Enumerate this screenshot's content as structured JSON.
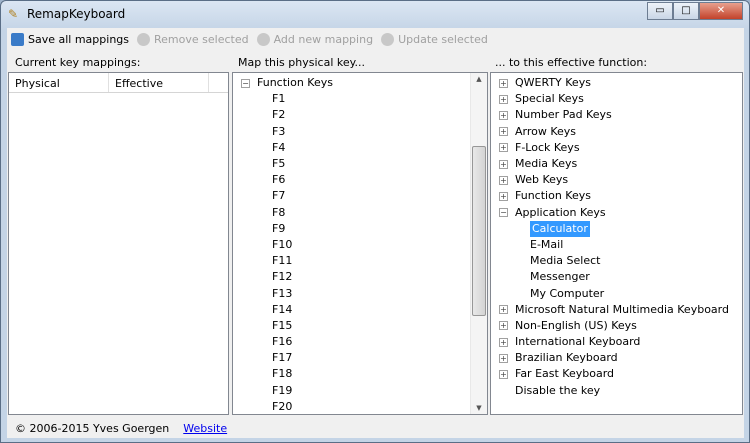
{
  "window": {
    "title": "RemapKeyboard",
    "min": "▭",
    "max": "□",
    "close": "✕"
  },
  "toolbar": {
    "save": "Save all mappings",
    "remove": "Remove selected",
    "add": "Add new mapping",
    "update": "Update selected"
  },
  "left": {
    "label": "Current key mappings:",
    "columns": [
      "Physical",
      "Effective"
    ]
  },
  "middle": {
    "label": "Map this physical key...",
    "root": "Function Keys",
    "items": [
      "F1",
      "F2",
      "F3",
      "F4",
      "F5",
      "F6",
      "F7",
      "F8",
      "F9",
      "F10",
      "F11",
      "F12",
      "F13",
      "F14",
      "F15",
      "F16",
      "F17",
      "F18",
      "F19",
      "F20"
    ]
  },
  "right": {
    "label": "... to this effective function:",
    "before": [
      "QWERTY Keys",
      "Special Keys",
      "Number Pad Keys",
      "Arrow Keys",
      "F-Lock Keys",
      "Media Keys",
      "Web Keys",
      "Function Keys"
    ],
    "expanded": "Application Keys",
    "children": [
      "Calculator",
      "E-Mail",
      "Media Select",
      "Messenger",
      "My Computer"
    ],
    "selected": "Calculator",
    "after": [
      "Microsoft Natural Multimedia Keyboard",
      "Non-English (US) Keys",
      "International Keyboard",
      "Brazilian Keyboard",
      "Far East Keyboard"
    ],
    "last": "Disable the key"
  },
  "footer": {
    "copyright": "© 2006-2015 Yves Goergen",
    "link": "Website"
  }
}
